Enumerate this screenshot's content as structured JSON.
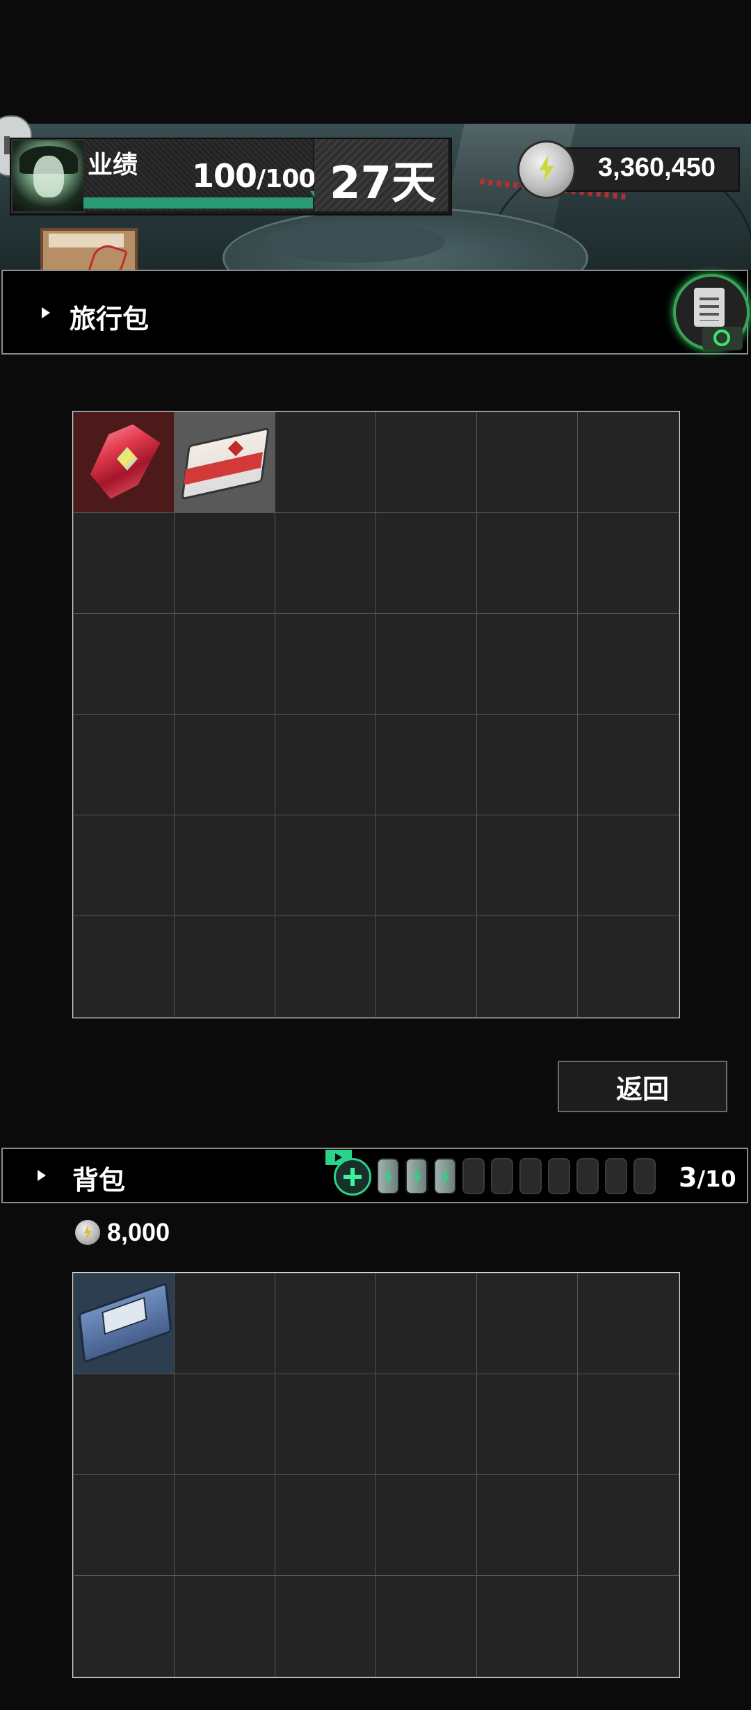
{
  "header": {
    "performance_label": "业绩",
    "performance_value": "100",
    "performance_max": "/100",
    "performance_fraction": 1.0,
    "days": "27天",
    "currency_icon": "lightning-coin-icon",
    "currency_value": "3,360,450"
  },
  "travel_bag": {
    "title": "旅行包",
    "inspect_icon": "clipboard-search-icon",
    "columns": 6,
    "rows": 6,
    "items": [
      {
        "slot": 0,
        "name": "red-crystal-icon",
        "bg": "#4d1a1c"
      },
      {
        "slot": 1,
        "name": "cigarette-pack-icon",
        "bg": "#595959"
      }
    ]
  },
  "return_button": "返回",
  "backpack": {
    "title": "背包",
    "battery_full": 3,
    "battery_total": 10,
    "slot_used": "3",
    "slot_total": "/10",
    "money_icon": "lightning-coin-icon",
    "money": "8,000",
    "columns": 6,
    "rows": 4,
    "items": [
      {
        "slot": 0,
        "name": "data-drive-icon",
        "bg": "#2c3e4f"
      }
    ]
  },
  "colors": {
    "accent_green": "#2b9a77",
    "slot_green": "#2bd38a",
    "background": "#0b0b0b"
  }
}
